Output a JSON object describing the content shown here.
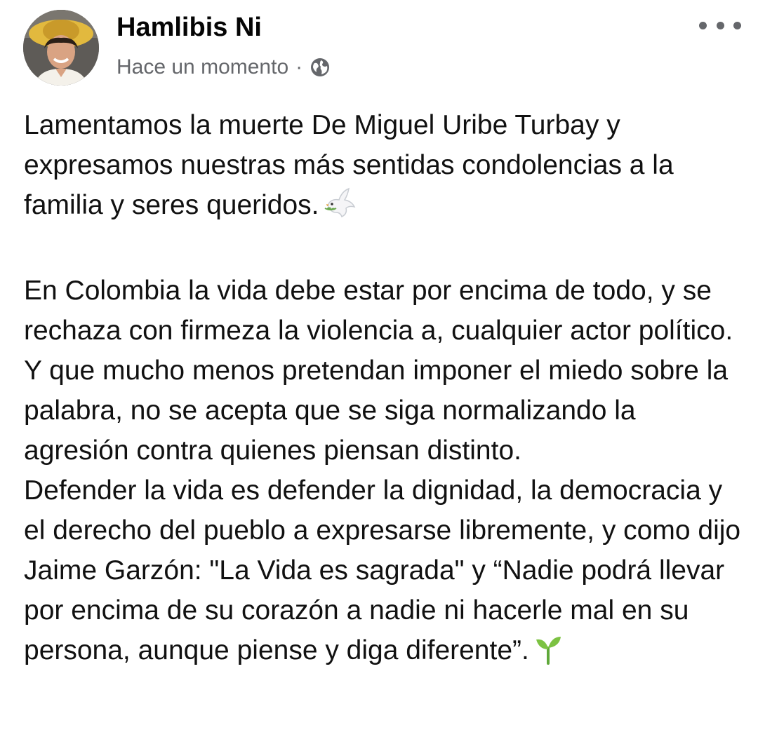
{
  "post": {
    "author": "Hamlibis Ni",
    "timestamp": "Hace un momento",
    "separator": "·",
    "privacy_icon": "globe-icon",
    "more_icon": "more-horizontal-icon",
    "paragraph_1": "Lamentamos la muerte De Miguel Uribe Turbay y expresamos nuestras más sentidas condolencias a la familia y seres queridos.",
    "paragraph_1_emoji": "dove-icon",
    "paragraph_2": "En Colombia la vida debe estar por encima de todo, y se rechaza con firmeza la violencia a, cualquier actor político. Y que mucho menos pretendan imponer el miedo sobre la palabra, no se acepta que se siga normalizando la agresión contra quienes piensan distinto.",
    "paragraph_3": "Defender la vida es defender la dignidad, la democracia y el derecho del pueblo a expresarse libremente, y como dijo Jaime Garzón: \"La Vida es sagrada\" y “Nadie podrá llevar por encima de su corazón a nadie ni hacerle mal en su persona, aunque piense y diga diferente”.",
    "paragraph_3_emoji": "seedling-icon"
  },
  "colors": {
    "text_primary": "#050505",
    "text_secondary": "#65676b",
    "seedling_green": "#7cc242"
  }
}
